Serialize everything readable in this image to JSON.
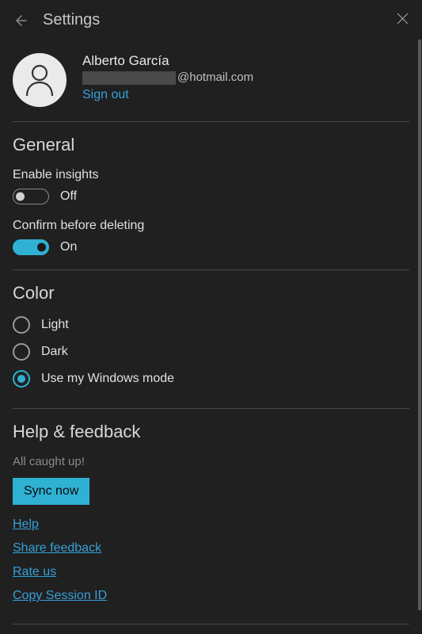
{
  "header": {
    "title": "Settings"
  },
  "account": {
    "name": "Alberto García",
    "email_domain": "@hotmail.com",
    "signout": "Sign out"
  },
  "general": {
    "title": "General",
    "insights": {
      "label": "Enable insights",
      "state": "Off",
      "on": false
    },
    "confirm_delete": {
      "label": "Confirm before deleting",
      "state": "On",
      "on": true
    }
  },
  "color": {
    "title": "Color",
    "options": {
      "light": "Light",
      "dark": "Dark",
      "windows": "Use my Windows mode"
    },
    "selected": "windows"
  },
  "help": {
    "title": "Help & feedback",
    "status": "All caught up!",
    "sync_btn": "Sync now",
    "links": {
      "help": "Help",
      "share": "Share feedback",
      "rate": "Rate us",
      "copy_session": "Copy Session ID"
    }
  }
}
